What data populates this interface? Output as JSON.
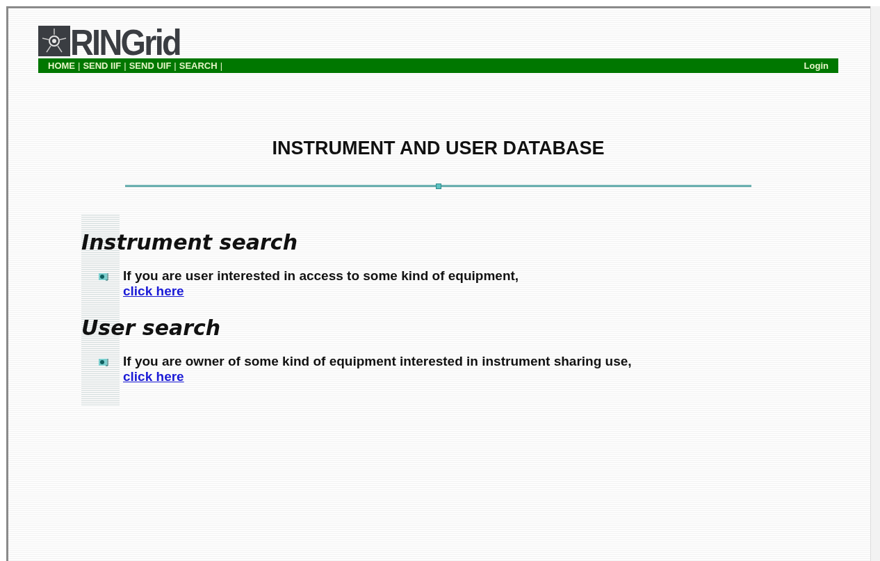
{
  "logo": {
    "text": "RINGrid"
  },
  "nav": {
    "items": [
      {
        "label": "HOME"
      },
      {
        "label": "SEND IIF"
      },
      {
        "label": "SEND UIF"
      },
      {
        "label": "SEARCH"
      }
    ],
    "separator": "|",
    "login": "Login"
  },
  "title": "INSTRUMENT AND USER DATABASE",
  "sections": [
    {
      "heading": "Instrument search",
      "text": "If you are user interested in access to some kind of equipment,",
      "link": "click here"
    },
    {
      "heading": "User search",
      "text": "If you are owner of some kind of equipment interested in instrument sharing use,",
      "link": "click here"
    }
  ]
}
